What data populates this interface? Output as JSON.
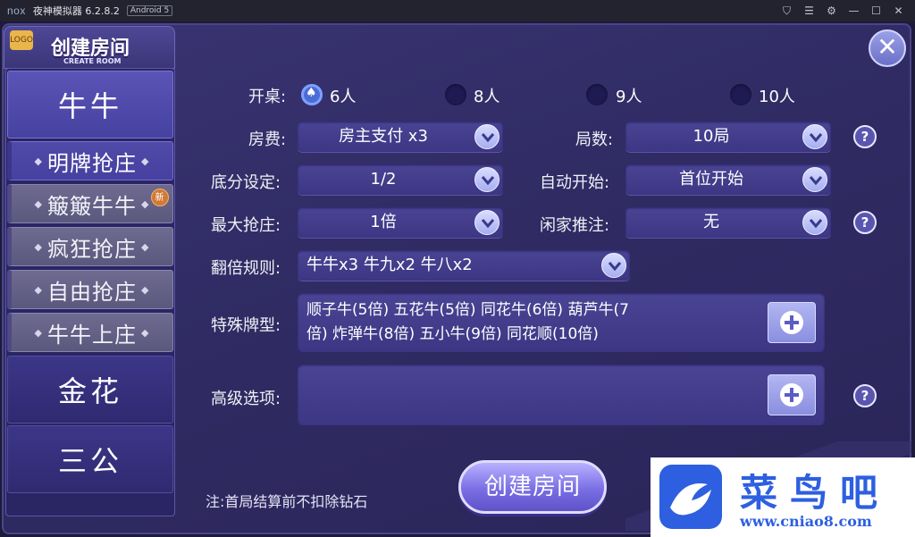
{
  "window": {
    "logo": "nox",
    "title": "夜神模拟器 6.2.8.2",
    "android": "Android 5",
    "controls": [
      "shirt-icon",
      "menu-icon",
      "gear-icon",
      "minimize-icon",
      "maximize-icon",
      "close-icon"
    ]
  },
  "header": {
    "badge": "LOGO",
    "title": "创建房间",
    "subtitle": "CREATE ROOM"
  },
  "sidebar": {
    "items": [
      {
        "label": "牛牛",
        "type": "main",
        "active": true
      },
      {
        "label": "明牌抢庄",
        "type": "sub",
        "active": true
      },
      {
        "label": "簸簸牛牛",
        "type": "sub",
        "badge": "新"
      },
      {
        "label": "疯狂抢庄",
        "type": "sub"
      },
      {
        "label": "自由抢庄",
        "type": "sub"
      },
      {
        "label": "牛牛上庄",
        "type": "sub"
      },
      {
        "label": "金花",
        "type": "main"
      },
      {
        "label": "三公",
        "type": "main"
      }
    ]
  },
  "form": {
    "table": {
      "label": "开桌:",
      "options": [
        "6人",
        "8人",
        "9人",
        "10人"
      ],
      "selected": "6人"
    },
    "fee": {
      "label": "房费:",
      "value": "房主支付 x3"
    },
    "rounds": {
      "label": "局数:",
      "value": "10局"
    },
    "base": {
      "label": "底分设定:",
      "value": "1/2"
    },
    "autostart": {
      "label": "自动开始:",
      "value": "首位开始"
    },
    "maxbanker": {
      "label": "最大抢庄:",
      "value": "1倍"
    },
    "idlebet": {
      "label": "闲家推注:",
      "value": "无"
    },
    "double": {
      "label": "翻倍规则:",
      "value": "牛牛x3  牛九x2  牛八x2"
    },
    "special": {
      "label": "特殊牌型:",
      "line1": "顺子牛(5倍)  五花牛(5倍)  同花牛(6倍)  葫芦牛(7",
      "line2": "倍)  炸弹牛(8倍)  五小牛(9倍)  同花顺(10倍)"
    },
    "advanced": {
      "label": "高级选项:",
      "value": ""
    }
  },
  "actions": {
    "create": "创建房间",
    "note": "注:首局结算前不扣除钻石"
  },
  "watermark": {
    "name": "菜鸟吧",
    "url": "www.cniao8.com"
  },
  "colors": {
    "panel": "#302b63",
    "accent": "#4a6cd6",
    "watermark": "#2d5fe0"
  }
}
